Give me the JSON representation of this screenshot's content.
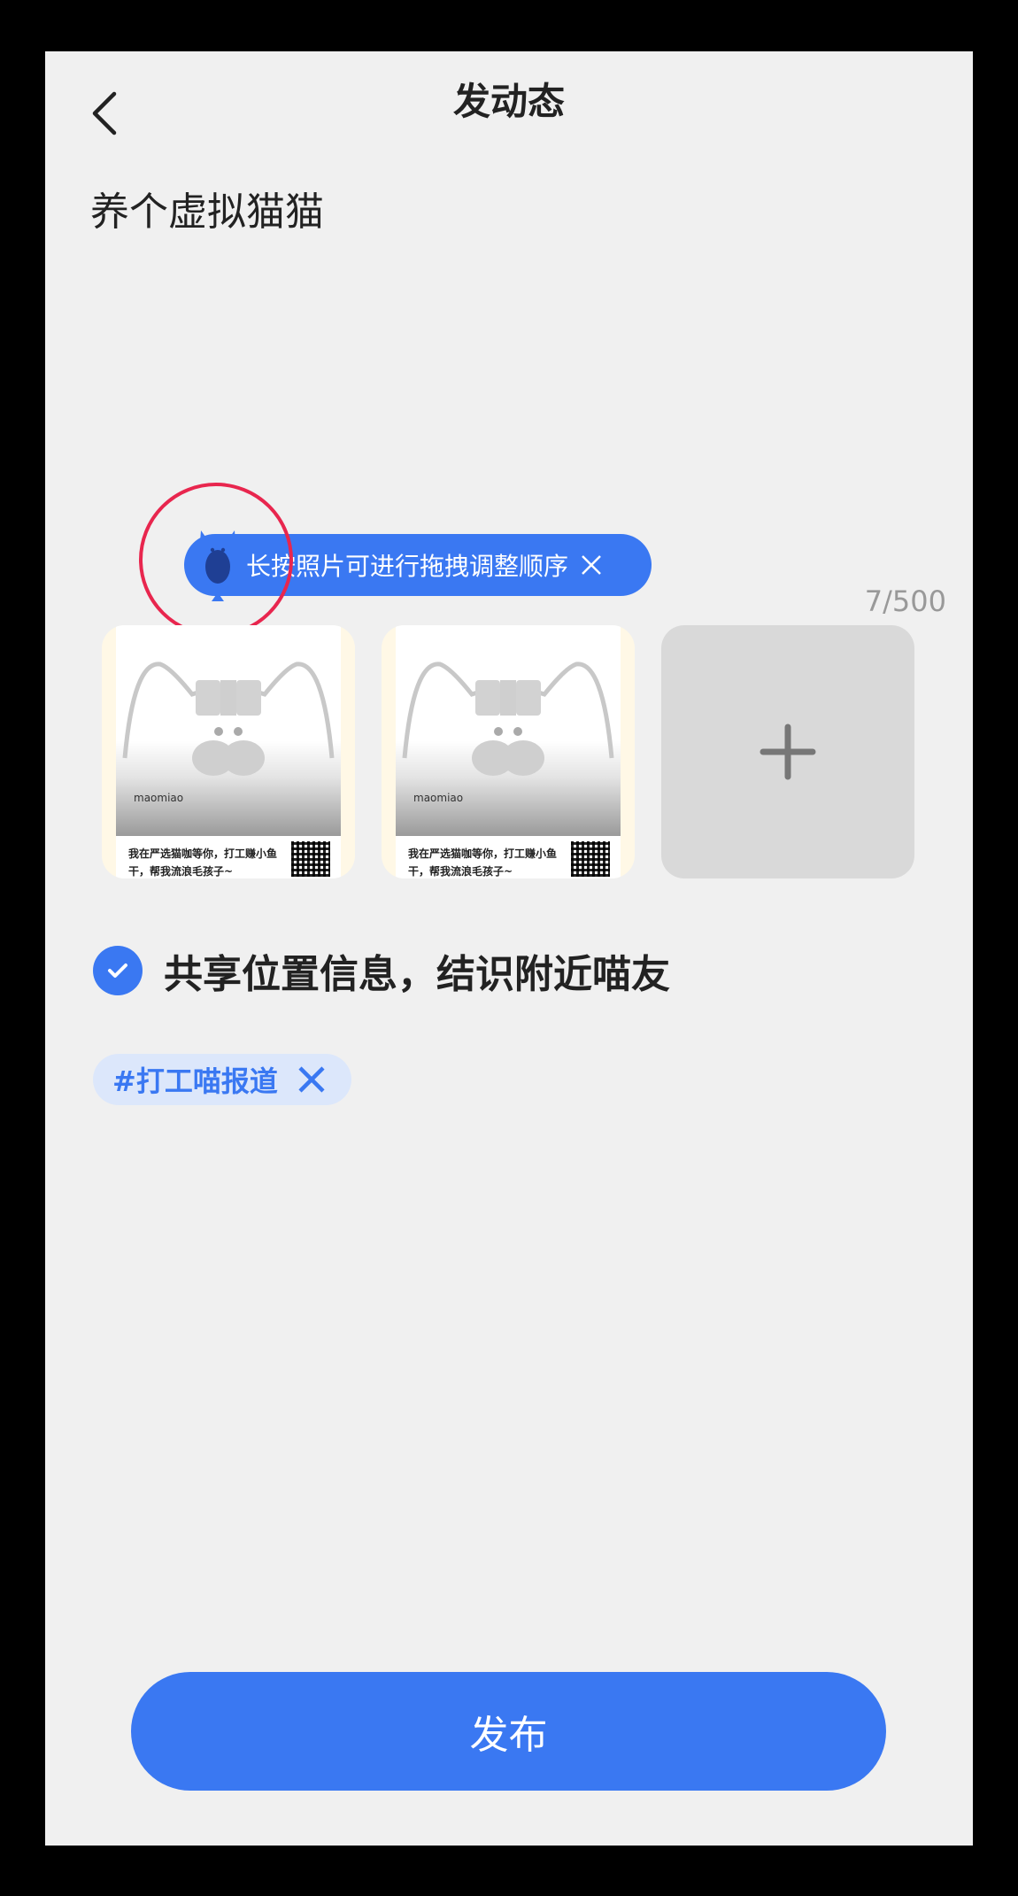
{
  "header": {
    "title": "发动态",
    "back_icon": "chevron-left-icon"
  },
  "post": {
    "text": "养个虚拟猫猫",
    "char_count": "7/500"
  },
  "tooltip": {
    "text": "长按照片可进行拖拽调整顺序",
    "close_icon": "close-icon",
    "mascot_icon": "cat-mascot-icon",
    "highlight_color": "#e8264e"
  },
  "photos": [
    {
      "brand": "maomiao",
      "caption": "我在严选猫咖等你，打工赚小鱼干，帮我流浪毛孩子~"
    },
    {
      "brand": "maomiao",
      "caption": "我在严选猫咖等你，打工赚小鱼干，帮我流浪毛孩子~"
    }
  ],
  "add_photo": {
    "icon": "plus-icon"
  },
  "location": {
    "checked": true,
    "label": "共享位置信息，结识附近喵友"
  },
  "topic": {
    "label": "#打工喵报道",
    "remove_icon": "close-icon"
  },
  "publish": {
    "label": "发布"
  },
  "colors": {
    "accent": "#3a78f2",
    "background": "#f0f0f0",
    "tag_background": "#dce7fb",
    "add_tile": "#d9d9d9"
  }
}
